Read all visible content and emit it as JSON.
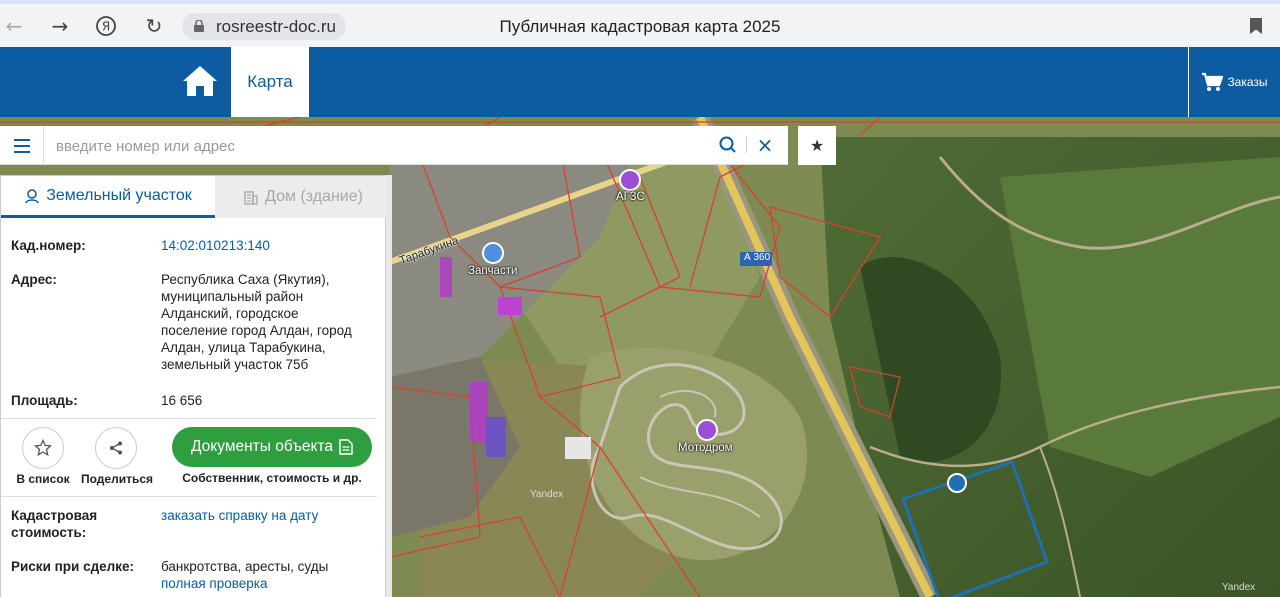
{
  "browser": {
    "url": "rosreestr-doc.ru",
    "title": "Публичная кадастровая карта 2025"
  },
  "header": {
    "tab_map": "Карта",
    "orders": "Заказы"
  },
  "search": {
    "placeholder": "введите номер или адрес",
    "value": ""
  },
  "panel": {
    "tab_land": "Земельный участок",
    "tab_house": "Дом (здание)",
    "cad_number_label": "Кад.номер:",
    "cad_number_value": "14:02:010213:140",
    "address_label": "Адрес:",
    "address_lines": [
      "Республика Саха (Якутия),",
      "муниципальный район",
      "Алданский, городское",
      "поселение город Алдан, город",
      "Алдан, улица Тарабукина,",
      "земельный участок 75б"
    ],
    "area_label": "Площадь:",
    "area_value": "16 656",
    "add_to_list": "В список",
    "share": "Поделиться",
    "docs_button": "Документы объекта",
    "docs_sub": "Собственник, стоимость и др.",
    "cad_cost_label_1": "Кадастровая",
    "cad_cost_label_2": "стоимость:",
    "cad_cost_link": "заказать справку на дату",
    "risks_label": "Риски при сделке:",
    "risks_value": "банкротства, аресты, суды",
    "risks_link": "полная проверка"
  },
  "map": {
    "labels": {
      "agzs": "АГЗС",
      "zapchasti": "Запчасти",
      "motodrom": "Мотодром",
      "street": "Тарабукина",
      "road": "А 360",
      "yandex1": "Yandex",
      "yandex2": "Yandex"
    }
  }
}
